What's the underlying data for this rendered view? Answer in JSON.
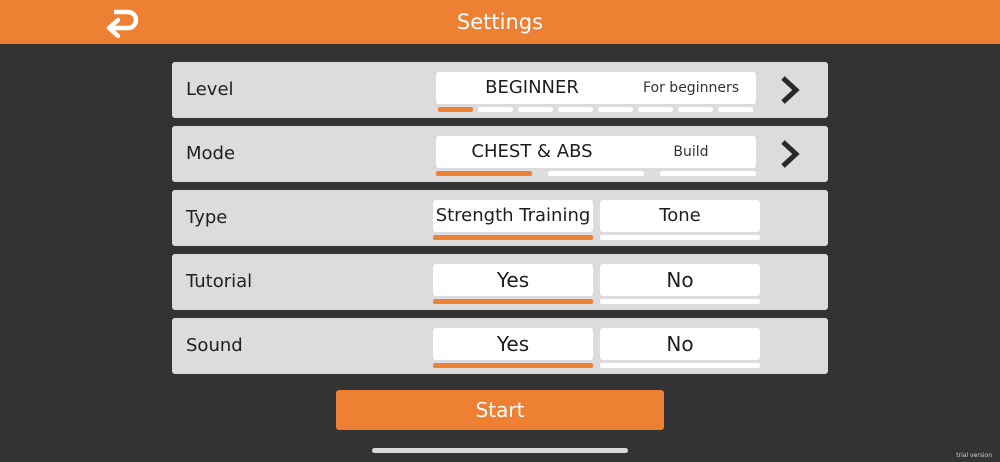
{
  "header": {
    "title": "Settings",
    "back_icon": "back-arrow-icon",
    "color": "#ee8033"
  },
  "rows": {
    "level": {
      "label": "Level",
      "value": "BEGINNER",
      "description": "For beginners",
      "step_current": 1,
      "step_total": 8,
      "next_icon": "chevron-right-icon"
    },
    "mode": {
      "label": "Mode",
      "value": "CHEST & ABS",
      "description": "Build",
      "step_current": 1,
      "step_total": 3,
      "next_icon": "chevron-right-icon"
    },
    "type": {
      "label": "Type",
      "options": [
        "Strength Training",
        "Tone"
      ],
      "selected": "Strength Training"
    },
    "tutorial": {
      "label": "Tutorial",
      "options": [
        "Yes",
        "No"
      ],
      "selected": "Yes"
    },
    "sound": {
      "label": "Sound",
      "options": [
        "Yes",
        "No"
      ],
      "selected": "Yes"
    }
  },
  "start_label": "Start",
  "watermark": "trial version",
  "colors": {
    "accent": "#ee8033",
    "background": "#333333",
    "row_bg": "#dcdcdc"
  }
}
